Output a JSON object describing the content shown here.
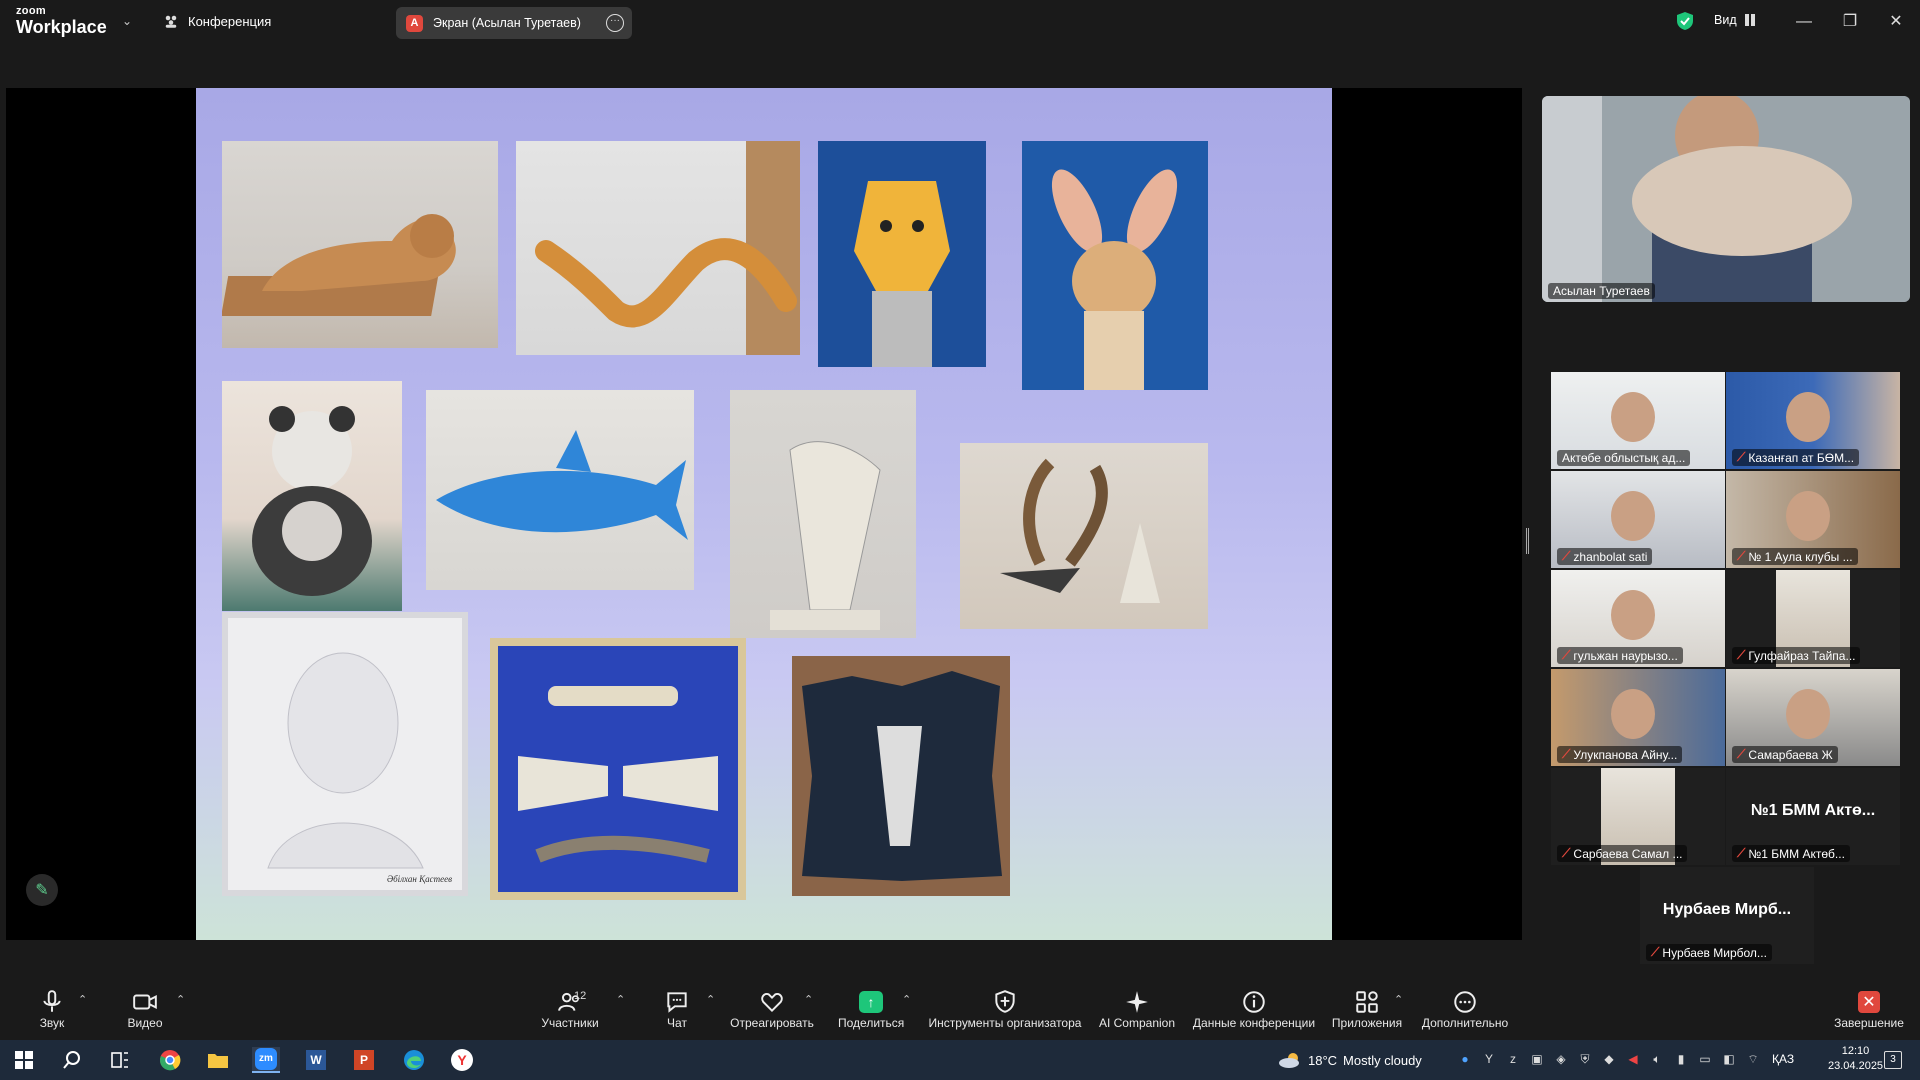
{
  "app": {
    "logo_top": "zoom",
    "logo_bottom": "Workplace",
    "conference_label": "Конференция",
    "screen_tab_badge": "А",
    "screen_tab_label": "Экран (Асылан Туретаев)",
    "view_label": "Вид",
    "accent_green": "#1ec67a",
    "alert_red": "#e0483d"
  },
  "speaker": {
    "name": "Асылан Туретаев"
  },
  "participants": [
    {
      "name": "Актөбе облыстық ад...",
      "muted": false
    },
    {
      "name": "Казанғап ат БӨМ...",
      "muted": true
    },
    {
      "name": "zhanbolat sati",
      "muted": true
    },
    {
      "name": "№ 1 Аула клубы ...",
      "muted": true
    },
    {
      "name": "гульжан наурызо...",
      "muted": true
    },
    {
      "name": "Гулфайраз Тайпа...",
      "muted": true
    },
    {
      "name": "Улукпанова Айну...",
      "muted": true
    },
    {
      "name": "Самарбаева Ж",
      "muted": true
    },
    {
      "name": "Сарбаева Самал ...",
      "muted": true
    },
    {
      "name": "№1 БМM  Актөб...",
      "muted": true,
      "big": "№1 БММ  Актө..."
    },
    {
      "name": "Нурбаев Мирбол...",
      "muted": true,
      "big": "Нурбаев  Мирб..."
    }
  ],
  "toolbar": {
    "audio": "Звук",
    "video": "Видео",
    "participants": "Участники",
    "participants_count": "12",
    "chat": "Чат",
    "react": "Отреагировать",
    "share": "Поделиться",
    "host_tools": "Инструменты организатора",
    "ai": "AI Companion",
    "meeting_info": "Данные конференции",
    "apps": "Приложения",
    "more": "Дополнительно",
    "end": "Завершение"
  },
  "taskbar": {
    "weather_temp": "18°C",
    "weather_text": "Mostly cloudy",
    "lang": "ҚАЗ",
    "time": "12:10",
    "date": "23.04.2025",
    "notifications": "3"
  },
  "slide": {
    "portrait_caption": "Әбілхан Қастеев"
  }
}
